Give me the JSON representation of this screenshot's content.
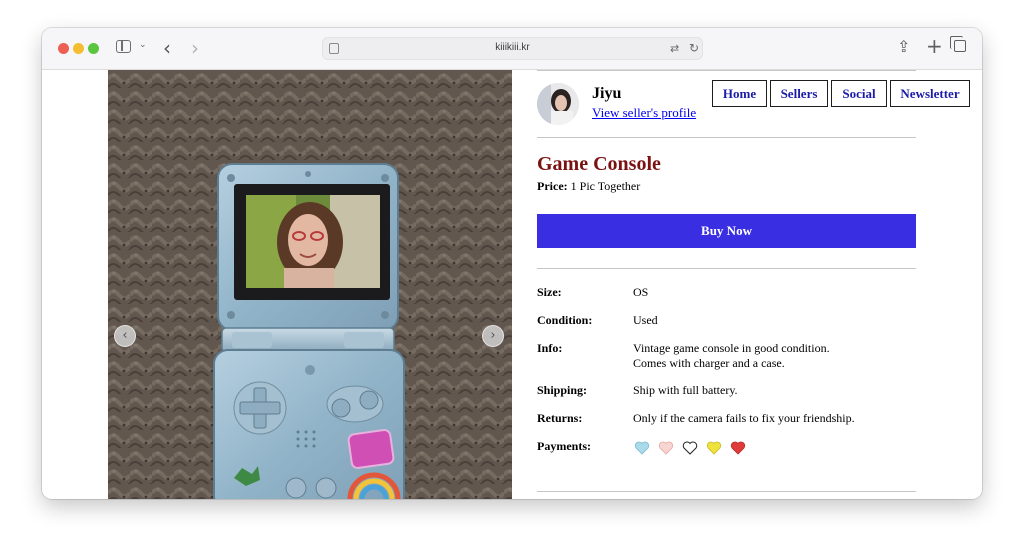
{
  "browser": {
    "url": "kiiikiii.kr"
  },
  "seller": {
    "name": "Jiyu",
    "profile_link": "View seller's profile"
  },
  "nav": [
    "Home",
    "Sellers",
    "Social",
    "Newsletter"
  ],
  "listing": {
    "title": "Game Console",
    "price_label": "Price:",
    "price_value": "1 Pic Together",
    "buy_label": "Buy Now"
  },
  "details": {
    "size_label": "Size:",
    "size_value": "OS",
    "condition_label": "Condition:",
    "condition_value": "Used",
    "info_label": "Info:",
    "info_line1": "Vintage game console in good condition.",
    "info_line2": "Comes with charger and a case.",
    "shipping_label": "Shipping:",
    "shipping_value": "Ship with full battery.",
    "returns_label": "Returns:",
    "returns_value": "Only if the camera fails to fix your friendship.",
    "payments_label": "Payments:"
  },
  "payments": [
    {
      "icon": "blue-heart-icon",
      "color": "#a9dbea"
    },
    {
      "icon": "pink-heart-icon",
      "color": "#f7d6d2"
    },
    {
      "icon": "outline-heart-icon",
      "color": "#ffffff"
    },
    {
      "icon": "yellow-heart-icon",
      "color": "#eee23c"
    },
    {
      "icon": "red-heart-icon",
      "color": "#e03b3b"
    }
  ],
  "colors": {
    "title": "#7b1212",
    "buy_button": "#3a2ee3",
    "nav_text": "#1c1ca8",
    "link": "#0000ee"
  }
}
